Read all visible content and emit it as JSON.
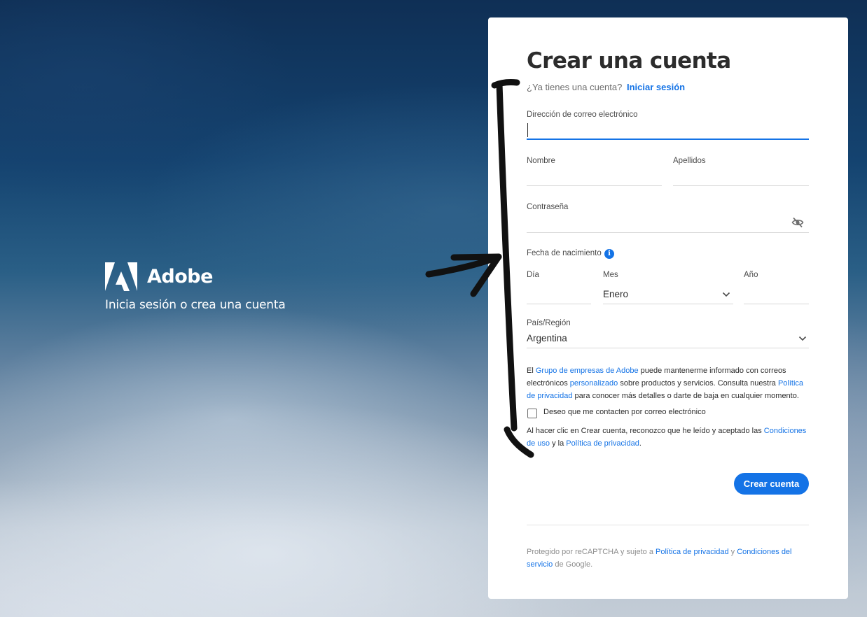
{
  "brand": {
    "name": "Adobe",
    "tagline": "Inicia sesión o crea una cuenta"
  },
  "form": {
    "title": "Crear una cuenta",
    "signin_prompt": "¿Ya tienes una cuenta?",
    "signin_link": "Iniciar sesión",
    "email": {
      "label": "Dirección de correo electrónico",
      "value": ""
    },
    "first_name": {
      "label": "Nombre",
      "value": ""
    },
    "last_name": {
      "label": "Apellidos",
      "value": ""
    },
    "password": {
      "label": "Contraseña",
      "value": "",
      "icon": "eye-slash-icon"
    },
    "dob": {
      "label": "Fecha de nacimiento",
      "info_icon": "info-icon",
      "day": {
        "label": "Día",
        "value": ""
      },
      "month": {
        "label": "Mes",
        "value": "Enero"
      },
      "year": {
        "label": "Año",
        "value": ""
      }
    },
    "country": {
      "label": "País/Región",
      "value": "Argentina"
    },
    "marketing": {
      "t1": "El ",
      "link1": "Grupo de empresas de Adobe",
      "t2": " puede mantenerme informado con correos electrónicos ",
      "link2": "personalizado",
      "t3": " sobre productos y servicios. Consulta nuestra ",
      "link3": "Política de privacidad",
      "t4": " para conocer más detalles o darte de baja en cualquier momento."
    },
    "contact_checkbox": {
      "label": "Deseo que me contacten por correo electrónico",
      "checked": false
    },
    "terms": {
      "t1": "Al hacer clic en Crear cuenta, reconozco que he leído y aceptado las ",
      "link1": "Condiciones de uso",
      "t2": " y la ",
      "link2": "Política de privacidad",
      "t3": "."
    },
    "submit_label": "Crear cuenta",
    "recaptcha": {
      "t1": "Protegido por reCAPTCHA y sujeto a ",
      "link1": "Política de privacidad",
      "t2": " y ",
      "link2": "Condiciones del servicio",
      "t3": " de Google."
    }
  },
  "colors": {
    "accent": "#1473e6",
    "text": "#2c2c2c",
    "annotation": "#111111"
  }
}
